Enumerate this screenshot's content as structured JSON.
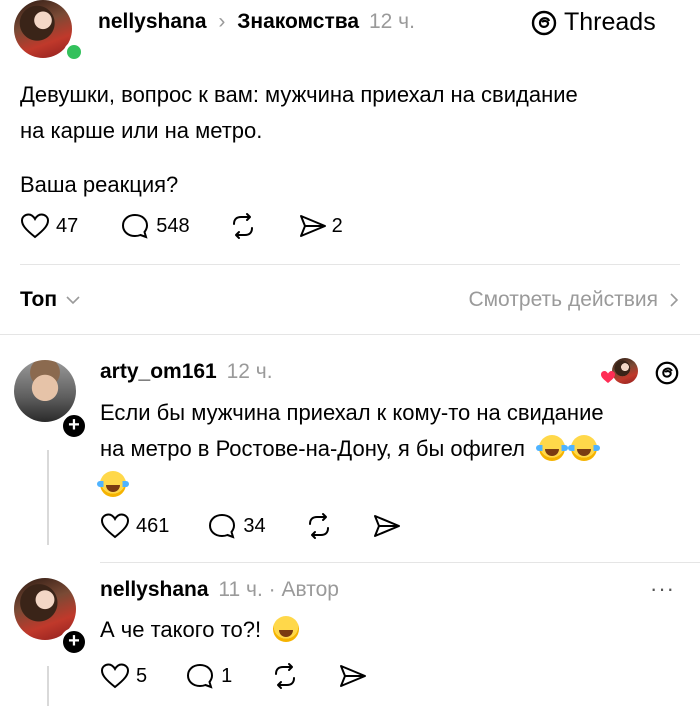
{
  "header": {
    "author": "nellyshana",
    "community": "Знакомства",
    "time": "12 ч.",
    "app_name": "Threads"
  },
  "post": {
    "line1": "Девушки, вопрос к вам: мужчина приехал на свидание",
    "line2": "на карше или на метро.",
    "line3": "Ваша реакция?",
    "likes": "47",
    "comments": "548",
    "shares": "2"
  },
  "filter": {
    "sort_label": "Топ",
    "view_activity": "Смотреть действия"
  },
  "reply1": {
    "author": "arty_om161",
    "time": "12 ч.",
    "line1": "Если бы мужчина приехал к кому-то на свидание",
    "line2": "на метро в Ростове-на-Дону, я бы офигел",
    "likes": "461",
    "comments": "34"
  },
  "reply2": {
    "author": "nellyshana",
    "time": "11 ч.",
    "author_tag": "· Автор",
    "text": "А че такого то?!",
    "likes": "5",
    "comments": "1",
    "more": "···"
  },
  "icons": {
    "threads_logo": "threads-logo-icon",
    "like": "heart-icon",
    "comment": "comment-bubble-icon",
    "repost": "repost-icon",
    "share": "send-icon",
    "chevron": "chevron-icon"
  }
}
